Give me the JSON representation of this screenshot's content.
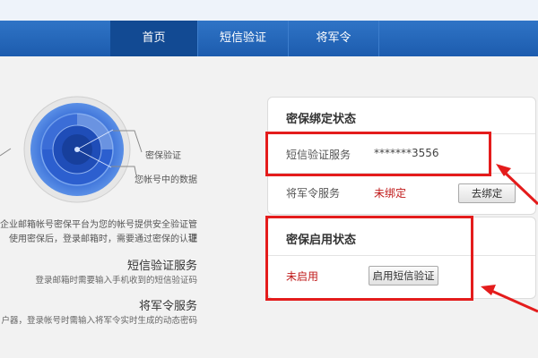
{
  "nav": {
    "items": [
      {
        "label": "首页",
        "active": true
      },
      {
        "label": "短信验证",
        "active": false
      },
      {
        "label": "将军令",
        "active": false
      }
    ]
  },
  "shield": {
    "callout_1": "密保验证",
    "callout_2": "您帐号中的数据"
  },
  "intro": {
    "line1": "企业邮箱帐号密保平台为您的帐号提供安全验证管理",
    "line2": "使用密保后，登录邮箱时，需要通过密保的认证"
  },
  "services": {
    "sms": {
      "title": "短信验证服务",
      "desc": "登录邮箱时需要输入手机收到的短信验证码"
    },
    "token": {
      "title": "将军令服务",
      "desc": "户器，登录帐号时需输入将军令实时生成的动态密码"
    }
  },
  "binding_panel": {
    "title": "密保绑定状态",
    "sms_label": "短信验证服务",
    "sms_value": "*******3556",
    "token_label": "将军令服务",
    "token_status": "未绑定",
    "token_button": "去绑定"
  },
  "enable_panel": {
    "title": "密保启用状态",
    "status": "未启用",
    "enable_button": "启用短信验证"
  },
  "colors": {
    "nav_bg": "#1d5cae",
    "nav_active": "#124a93",
    "status_red": "#c01a1a",
    "highlight_red": "#e41c1c",
    "shield_blue": "#2f6fd8"
  }
}
